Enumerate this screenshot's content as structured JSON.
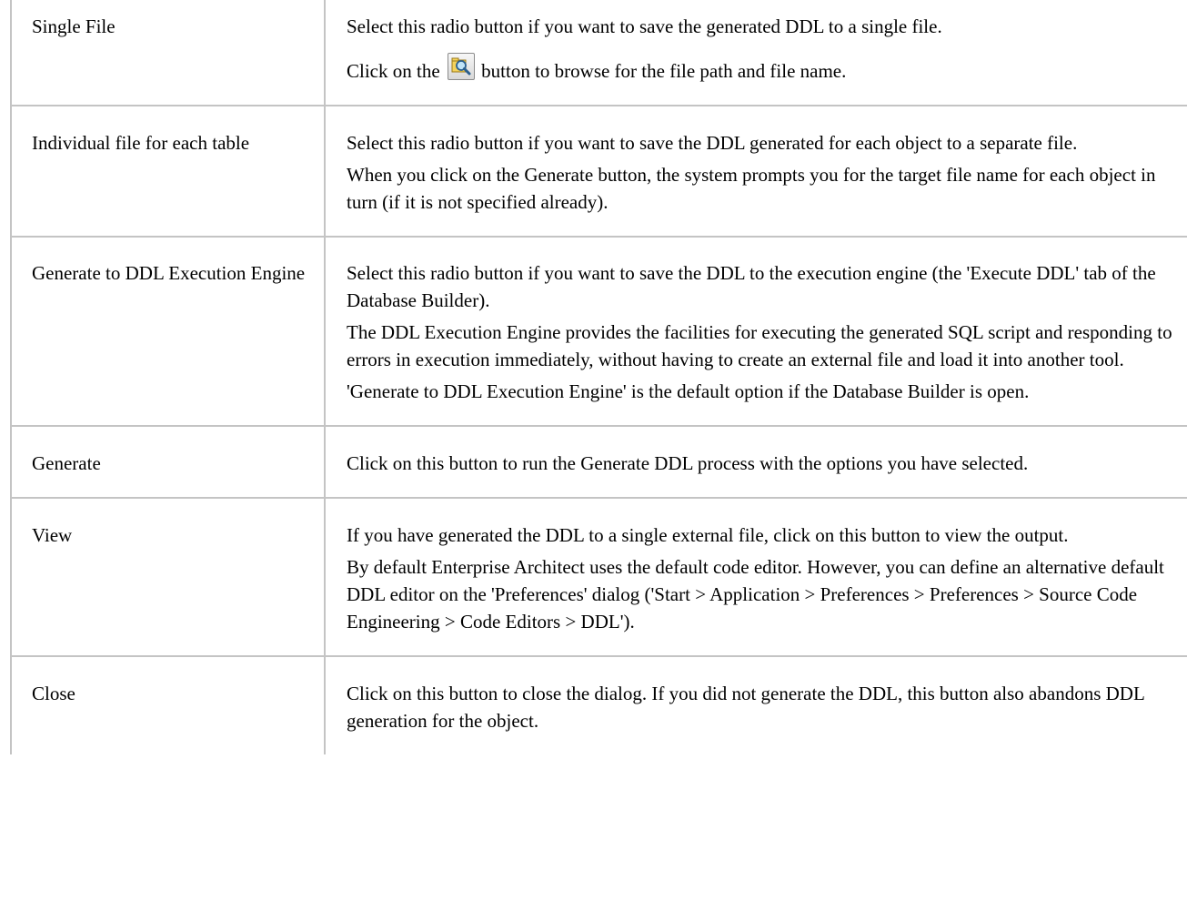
{
  "rows": [
    {
      "option": "Single File",
      "paragraphs": [
        "Select this radio button if you want to save the generated DDL to a single file."
      ],
      "browse_before": "Click on the",
      "browse_after": "button to browse for the file path and file name.",
      "browse_icon": "folder-search-icon"
    },
    {
      "option": "Individual file for each table",
      "paragraphs": [
        "Select this radio button if you want to save the DDL generated for each object to a separate file.",
        "When you click on the Generate button, the system prompts you for the target file name for each object in turn (if it is not specified already)."
      ]
    },
    {
      "option": "Generate to DDL Execution Engine",
      "paragraphs": [
        "Select this radio button if you want to save the DDL to the execution engine (the 'Execute DDL' tab of the Database Builder).",
        "The DDL Execution Engine provides the facilities for executing the generated SQL script and responding to errors in execution immediately, without having to create an external file and load it into another tool.",
        "'Generate to DDL Execution Engine' is the default option if the Database Builder is open."
      ]
    },
    {
      "option": "Generate",
      "paragraphs": [
        "Click on this button to run the Generate DDL process with the options you have selected."
      ]
    },
    {
      "option": "View",
      "paragraphs": [
        "If you have generated the DDL to a single external file, click on this button to view the output.",
        "By default Enterprise Architect uses the default code editor. However, you can define an alternative default DDL editor on the 'Preferences' dialog ('Start > Application > Preferences > Preferences > Source Code Engineering > Code Editors > DDL')."
      ]
    },
    {
      "option": "Close",
      "paragraphs": [
        "Click on this button to close the dialog. If you did not generate the DDL, this button also abandons DDL generation for the object."
      ]
    }
  ]
}
